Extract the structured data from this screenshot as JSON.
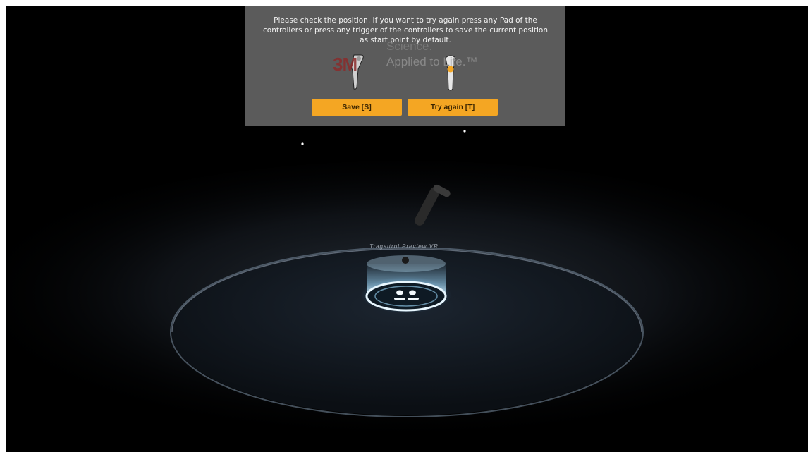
{
  "dialog": {
    "message": "Please check the position. If you want to try again press any Pad of the controllers or press any trigger of the controllers to save the current position as start point by default.",
    "save_label": "Save [S]",
    "try_again_label": "Try again [T]"
  },
  "brand": {
    "logo_text": "3M",
    "line1": "Science.",
    "line2": "Applied to Life.™"
  },
  "platform": {
    "label": "Tragsitrol Preview VR"
  },
  "icons": {
    "left_controller": "vr-controller-icon",
    "right_controller": "vr-controller-trigger-icon",
    "floating_controller": "vr-controller-icon",
    "teleport_pad": "footprints-icon"
  },
  "colors": {
    "background": "#000000",
    "panel": "#5b5b5b",
    "accent": "#f4a623",
    "glow": "#8fd3ff"
  }
}
